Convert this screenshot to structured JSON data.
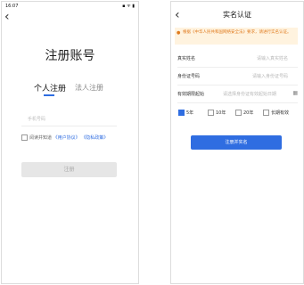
{
  "left_screen": {
    "status": {
      "time": "16:07",
      "icons": "▪ ᯤ ▮"
    },
    "back_glyph": "‹",
    "title": "注册账号",
    "tabs": [
      "个人注册",
      "法人注册"
    ],
    "phone_placeholder": "手机号码",
    "agreement": {
      "prefix": "阅读并知道",
      "link1": "《用户协议》",
      "link2": "《隐私政策》"
    },
    "register_button": "注册"
  },
  "right_screen": {
    "back_glyph": "‹",
    "title": "实名认证",
    "notice": "根据《中华人民共和国网络安全法》要求，请进行实名认证。",
    "fields": [
      {
        "label": "真实姓名",
        "placeholder": "请输入真实姓名"
      },
      {
        "label": "身份证号码",
        "placeholder": "请输入身份证号码"
      },
      {
        "label": "有效期限起始",
        "placeholder": "请选择身份证有效起始日期"
      }
    ],
    "validity_options": [
      "5年",
      "10年",
      "20年",
      "长期有效"
    ],
    "selected_option": "5年",
    "submit_button": "注册并实名",
    "accent_color": "#2f6de1",
    "notice_color": "#e07b1f"
  }
}
